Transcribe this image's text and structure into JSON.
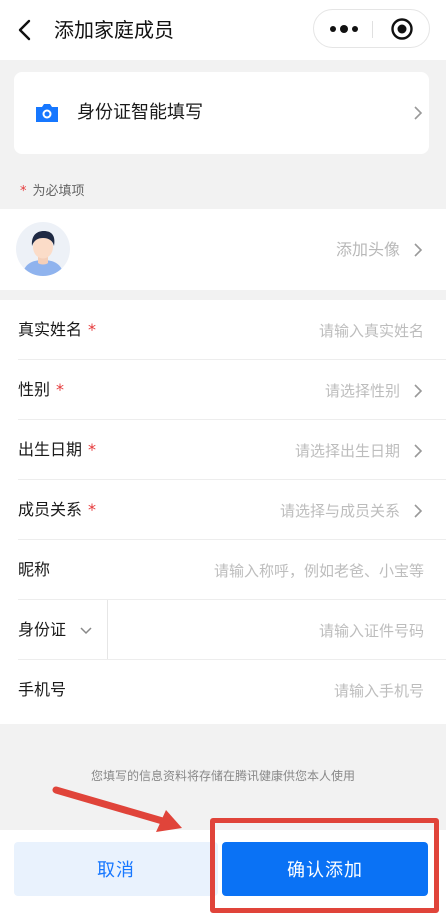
{
  "header": {
    "title": "添加家庭成员",
    "back_icon": "chevron-left-icon",
    "more_icon": "more-dots-icon",
    "target_icon": "target-circle-icon"
  },
  "id_card_fill": {
    "label": "身份证智能填写",
    "icon": "camera-icon"
  },
  "required_note": {
    "star": "*",
    "text": "为必填项"
  },
  "avatar_row": {
    "placeholder": "添加头像"
  },
  "form": {
    "rows": [
      {
        "label": "真实姓名",
        "required": "*",
        "placeholder": "请输入真实姓名"
      },
      {
        "label": "性别",
        "required": "*",
        "placeholder": "请选择性别"
      },
      {
        "label": "出生日期",
        "required": "*",
        "placeholder": "请选择出生日期"
      },
      {
        "label": "成员关系",
        "required": "*",
        "placeholder": "请选择与成员关系"
      },
      {
        "label": "昵称",
        "placeholder": "请输入称呼，例如老爸、小宝等"
      },
      {
        "label": "身份证",
        "placeholder": "请输入证件号码"
      },
      {
        "label": "手机号",
        "placeholder": "请输入手机号"
      }
    ]
  },
  "info_text": "您填写的信息资料将存储在腾讯健康供您本人使用",
  "buttons": {
    "cancel": "取消",
    "confirm": "确认添加"
  },
  "colors": {
    "accent": "#0a72f5",
    "required": "#e5393a",
    "annotation": "#e0443a"
  }
}
